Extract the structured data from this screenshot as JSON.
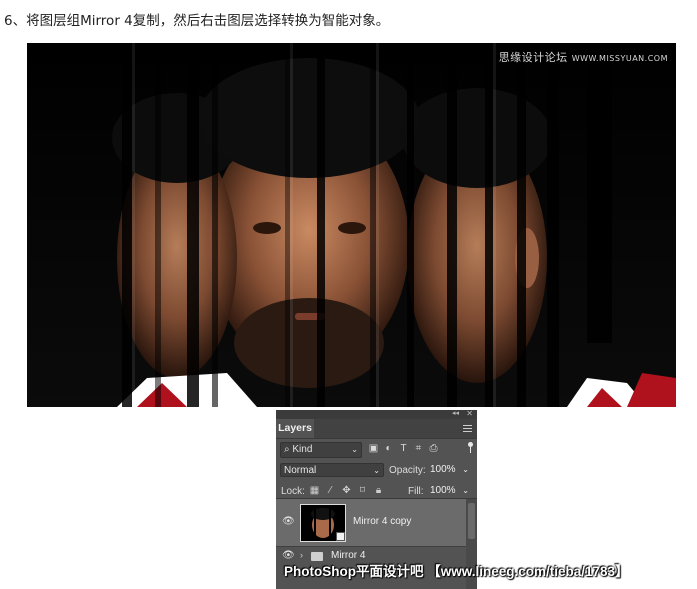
{
  "instruction": "6、将图层组Mirror 4复制，然后右击图层选择转换为智能对象。",
  "hero": {
    "watermark_brand": "思缘设计论坛",
    "watermark_url": "WWW.MISSYUAN.COM"
  },
  "layers_panel": {
    "tab_label": "Layers",
    "filter": {
      "kind_label": "Kind",
      "icons": [
        "image-filter-icon",
        "adjustment-filter-icon",
        "type-filter-icon",
        "shape-filter-icon",
        "smart-object-filter-icon"
      ]
    },
    "blend_mode": "Normal",
    "opacity_label": "Opacity:",
    "opacity_value": "100%",
    "lock_label": "Lock:",
    "lock_icons": [
      "lock-transparent-icon",
      "lock-brush-icon",
      "lock-position-icon",
      "lock-artboard-icon",
      "lock-all-icon"
    ],
    "fill_label": "Fill:",
    "fill_value": "100%",
    "layers": [
      {
        "name": "Mirror 4 copy",
        "type": "smart-object",
        "selected": true
      },
      {
        "name": "Mirror 4",
        "type": "group",
        "selected": false
      }
    ]
  },
  "banner": "PhotoShop平面设计吧 【www.lineeg.com/tieba/1783】",
  "colors": {
    "panel_bg": "#535353",
    "selected_row": "#6b6b6b",
    "hero_bg": "#050505"
  }
}
